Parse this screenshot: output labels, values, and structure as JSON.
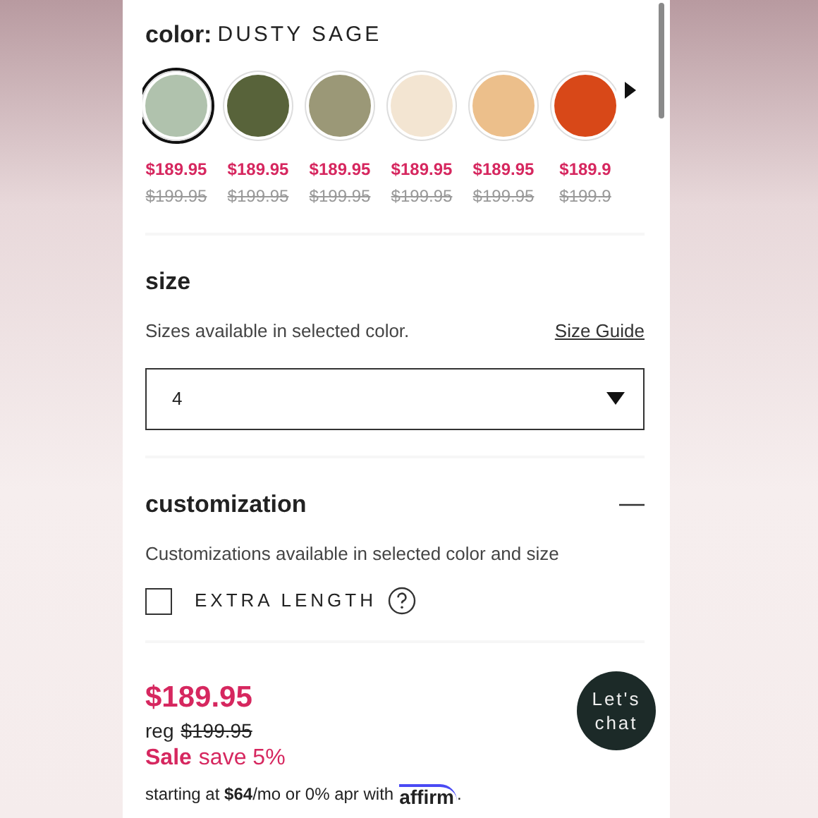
{
  "color": {
    "label": "color:",
    "value": "DUSTY SAGE",
    "swatches": [
      {
        "color": "#b0c2ad",
        "selected": true,
        "price": "$189.95",
        "regular_price": "$199.95"
      },
      {
        "color": "#58633a",
        "selected": false,
        "price": "$189.95",
        "regular_price": "$199.95"
      },
      {
        "color": "#9b9877",
        "selected": false,
        "price": "$189.95",
        "regular_price": "$199.95"
      },
      {
        "color": "#f3e5d2",
        "selected": false,
        "price": "$189.95",
        "regular_price": "$199.95"
      },
      {
        "color": "#ecbf8b",
        "selected": false,
        "price": "$189.95",
        "regular_price": "$199.95"
      },
      {
        "color": "#d84818",
        "selected": false,
        "price": "$189.9",
        "regular_price": "$199.9"
      }
    ]
  },
  "size": {
    "title": "size",
    "note": "Sizes available in selected color.",
    "guide_link": "Size Guide",
    "select": {
      "value": "4"
    }
  },
  "customization": {
    "title": "customization",
    "expanded": true,
    "note": "Customizations available in selected color and size",
    "options": [
      {
        "label": "EXTRA LENGTH",
        "checked": false
      }
    ]
  },
  "price": {
    "sale_price": "$189.95",
    "reg_label": "reg",
    "regular_price": "$199.95",
    "sale_label": "Sale",
    "savings": "save 5%",
    "financing": "starting at **$64**/mo or 0% apr with",
    "financing_brand": "affirm",
    "financing_end": "."
  },
  "chat_button": "Let's chat"
}
